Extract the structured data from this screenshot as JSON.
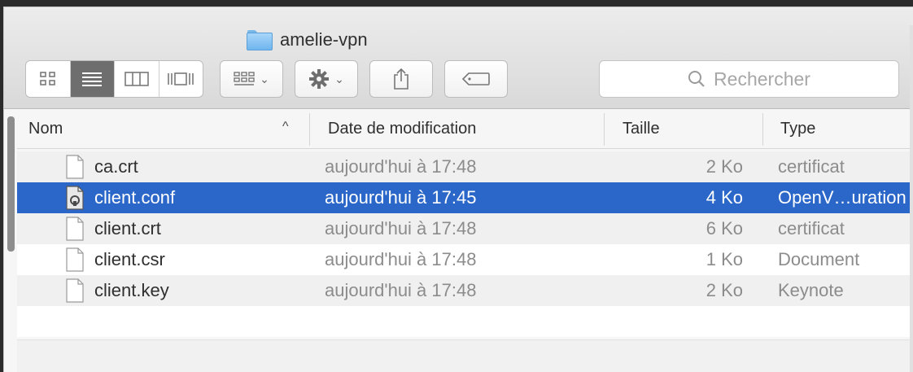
{
  "window": {
    "title": "amelie-vpn"
  },
  "toolbar": {
    "view_buttons": [
      {
        "icon": "icon-view-icon",
        "active": false
      },
      {
        "icon": "list-view-icon",
        "active": true
      },
      {
        "icon": "column-view-icon",
        "active": false
      },
      {
        "icon": "cover-flow-view-icon",
        "active": false
      }
    ],
    "arrange_icon": "arrange-grid-icon",
    "action_icon": "gear-icon",
    "share_icon": "share-icon",
    "tags_icon": "tag-icon",
    "search": {
      "placeholder": "Rechercher",
      "icon": "search-icon"
    }
  },
  "columns": {
    "name": "Nom",
    "date": "Date de modification",
    "size": "Taille",
    "type": "Type",
    "sort_indicator": "^"
  },
  "files": [
    {
      "name": "ca.crt",
      "date": "aujourd'hui à 17:48",
      "size": "2 Ko",
      "type": "certificat",
      "selected": false
    },
    {
      "name": "client.conf",
      "date": "aujourd'hui à 17:45",
      "size": "4 Ko",
      "type": "OpenV…uration",
      "selected": true
    },
    {
      "name": "client.crt",
      "date": "aujourd'hui à 17:48",
      "size": "6 Ko",
      "type": "certificat",
      "selected": false
    },
    {
      "name": "client.csr",
      "date": "aujourd'hui à 17:48",
      "size": "1 Ko",
      "type": "Document",
      "selected": false
    },
    {
      "name": "client.key",
      "date": "aujourd'hui à 17:48",
      "size": "2 Ko",
      "type": "Keynote",
      "selected": false
    }
  ],
  "colors": {
    "selection": "#2b67c8",
    "folder": "#78b9ea"
  }
}
